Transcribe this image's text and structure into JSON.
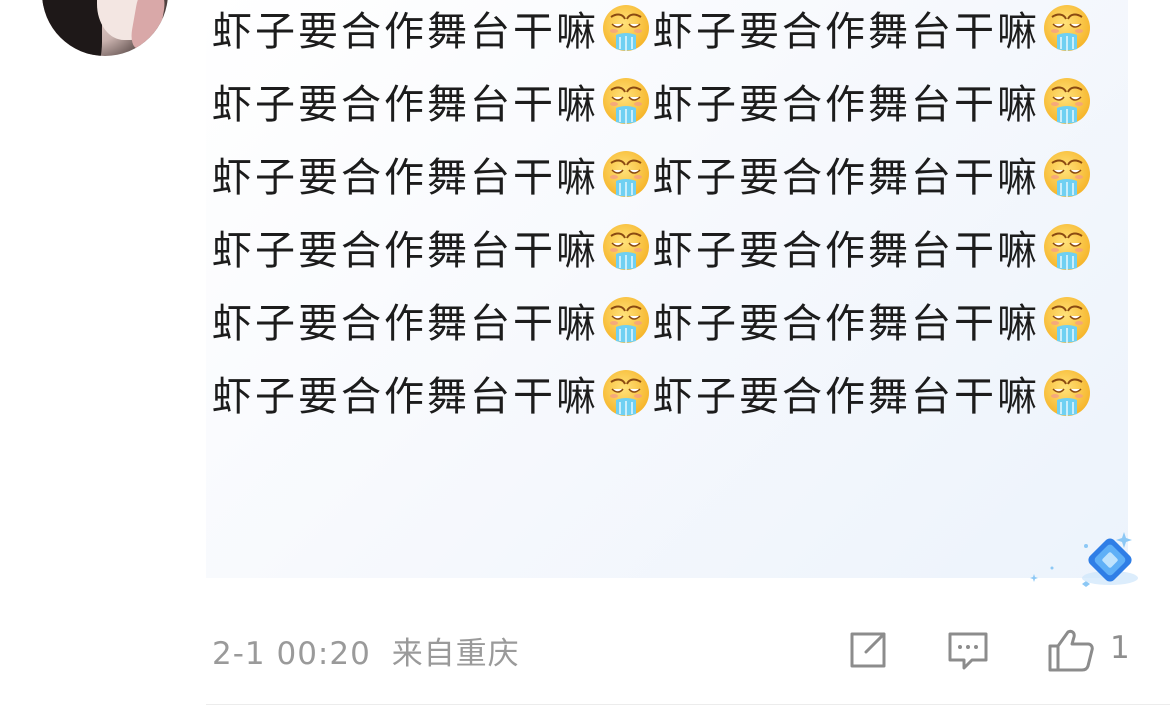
{
  "comment": {
    "segments": [
      "虾子要合作舞台干嘛",
      "emoji",
      "虾子要合作舞台干嘛",
      "emoji",
      "虾子要合作舞台干嘛",
      "emoji",
      "虾子要合作舞台干嘛",
      "emoji",
      "虾子要合作舞台干嘛",
      "emoji",
      "虾子要合作舞台干嘛",
      "emoji",
      "虾子要合作舞台干嘛",
      "emoji",
      "虾子要合作舞台干嘛",
      "emoji",
      "虾子要合作舞台干嘛",
      "emoji",
      "虾子要合作舞台干嘛",
      "emoji",
      "虾子要合作舞台干嘛",
      "emoji",
      "虾子要合作舞台干嘛",
      "emoji"
    ],
    "emoji_icon": "drooling-face-icon",
    "timestamp": "2-1 00:20",
    "location": "来自重庆",
    "like_count": "1"
  },
  "icons": {
    "share": "share-icon",
    "comment": "comment-icon",
    "like": "thumbs-up-icon",
    "badge": "diamond-badge-icon"
  },
  "colors": {
    "text": "#1c1c1c",
    "meta": "#9a9a9a",
    "badge": "#4a9cf0"
  }
}
